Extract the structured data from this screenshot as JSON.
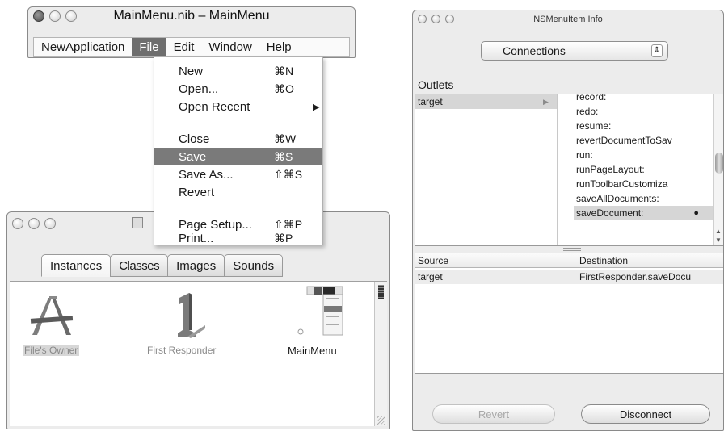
{
  "nib_window": {
    "title": "MainMenu.nib – MainMenu",
    "menubar": [
      "NewApplication",
      "File",
      "Edit",
      "Window",
      "Help"
    ]
  },
  "file_menu": {
    "items": [
      {
        "label": "New",
        "shortcut": "⌘N"
      },
      {
        "label": "Open...",
        "shortcut": "⌘O"
      },
      {
        "label": "Open Recent",
        "shortcut": "▶"
      },
      {
        "label": "Close",
        "shortcut": "⌘W"
      },
      {
        "label": "Save",
        "shortcut": "⌘S"
      },
      {
        "label": "Save As...",
        "shortcut": "⇧⌘S"
      },
      {
        "label": "Revert",
        "shortcut": ""
      },
      {
        "label": "Page Setup...",
        "shortcut": "⇧⌘P"
      },
      {
        "label": "Print...",
        "shortcut": "⌘P"
      }
    ],
    "selected": "Save"
  },
  "instances_window": {
    "tabs": [
      "Instances",
      "Classes",
      "Images",
      "Sounds"
    ],
    "selected_tab": "Instances",
    "objects": [
      "File's Owner",
      "First Responder",
      "MainMenu"
    ]
  },
  "info_panel": {
    "title": "NSMenuItem Info",
    "popup_value": "Connections",
    "outlets_label": "Outlets",
    "outlets": [
      "target"
    ],
    "actions": [
      "record:",
      "redo:",
      "resume:",
      "revertDocumentToSav",
      "run:",
      "runPageLayout:",
      "runToolbarCustomiza",
      "saveAllDocuments:",
      "saveDocument:"
    ],
    "selected_action": "saveDocument:",
    "connections": {
      "headers": [
        "Source",
        "Destination"
      ],
      "rows": [
        {
          "source": "target",
          "destination": "FirstResponder.saveDocu"
        }
      ]
    },
    "buttons": {
      "revert": "Revert",
      "disconnect": "Disconnect"
    }
  }
}
